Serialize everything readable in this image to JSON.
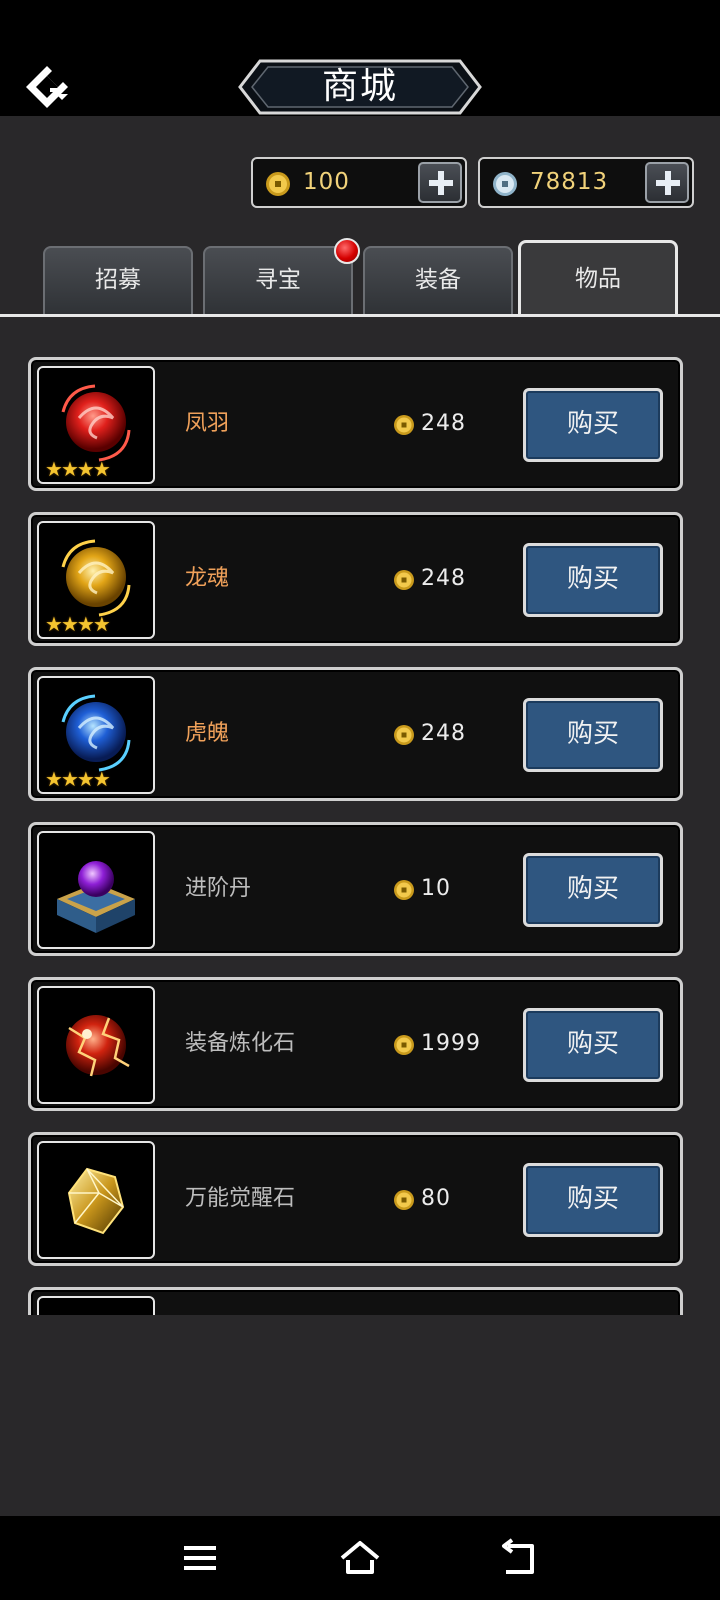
{
  "header": {
    "title": "商城",
    "back_icon": "game-logo-back-icon"
  },
  "currencies": [
    {
      "icon": "gold-coin-icon",
      "value": "100"
    },
    {
      "icon": "silver-coin-icon",
      "value": "78813"
    }
  ],
  "tabs": [
    {
      "label": "招募",
      "active": false
    },
    {
      "label": "寻宝",
      "active": false,
      "badge": true
    },
    {
      "label": "装备",
      "active": false
    },
    {
      "label": "物品",
      "active": true
    }
  ],
  "items": [
    {
      "name": "凤羽",
      "rarity_stars": 4,
      "price": "248",
      "buy_label": "购买",
      "icon": "red-orb-icon",
      "name_color": "#f0a15a"
    },
    {
      "name": "龙魂",
      "rarity_stars": 4,
      "price": "248",
      "buy_label": "购买",
      "icon": "gold-orb-icon",
      "name_color": "#f0a15a"
    },
    {
      "name": "虎魄",
      "rarity_stars": 4,
      "price": "248",
      "buy_label": "购买",
      "icon": "blue-orb-icon",
      "name_color": "#f0a15a"
    },
    {
      "name": "进阶丹",
      "rarity_stars": 0,
      "price": "10",
      "buy_label": "购买",
      "icon": "purple-pill-chest-icon",
      "name_color": "#bdbdbd"
    },
    {
      "name": "装备炼化石",
      "rarity_stars": 0,
      "price": "1999",
      "buy_label": "购买",
      "icon": "red-refine-stone-icon",
      "name_color": "#bdbdbd"
    },
    {
      "name": "万能觉醒石",
      "rarity_stars": 0,
      "price": "80",
      "buy_label": "购买",
      "icon": "gold-crystal-icon",
      "name_color": "#bdbdbd"
    }
  ],
  "navbar": {
    "menu_icon": "menu-icon",
    "home_icon": "home-icon",
    "back_icon": "back-icon"
  },
  "colors": {
    "background": "#29282a",
    "buy_button": "#2f5680",
    "price_text": "#ececec",
    "rare_name": "#f0a15a",
    "common_name": "#bdbdbd",
    "currency_text": "#f1d27a"
  }
}
